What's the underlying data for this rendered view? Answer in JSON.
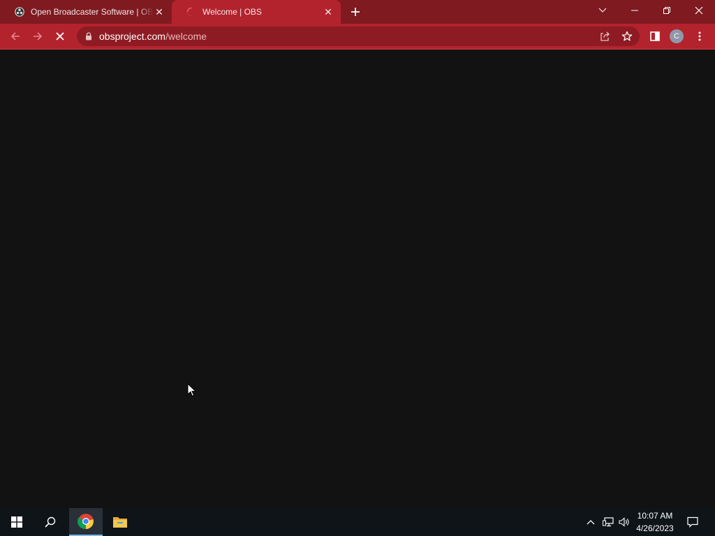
{
  "browser": {
    "tabs": [
      {
        "title": "Open Broadcaster Software | OBS",
        "active": false,
        "favicon": "obs-logo-icon"
      },
      {
        "title": "Welcome | OBS",
        "active": true,
        "favicon": "loading-spinner-icon"
      }
    ],
    "new_tab_icon": "plus-icon",
    "address": {
      "host": "obsproject.com",
      "path": "/welcome"
    },
    "profile_initial": "C",
    "theme": {
      "frame": "#7e1a20",
      "toolbar": "#b3232d",
      "omnibox": "#8e1b23"
    }
  },
  "page": {
    "background": "#121212",
    "state": "loading"
  },
  "taskbar": {
    "time": "10:07 AM",
    "date": "4/26/2023",
    "pinned": [
      "windows-start-icon",
      "search-icon",
      "chrome-icon",
      "file-explorer-icon"
    ]
  }
}
